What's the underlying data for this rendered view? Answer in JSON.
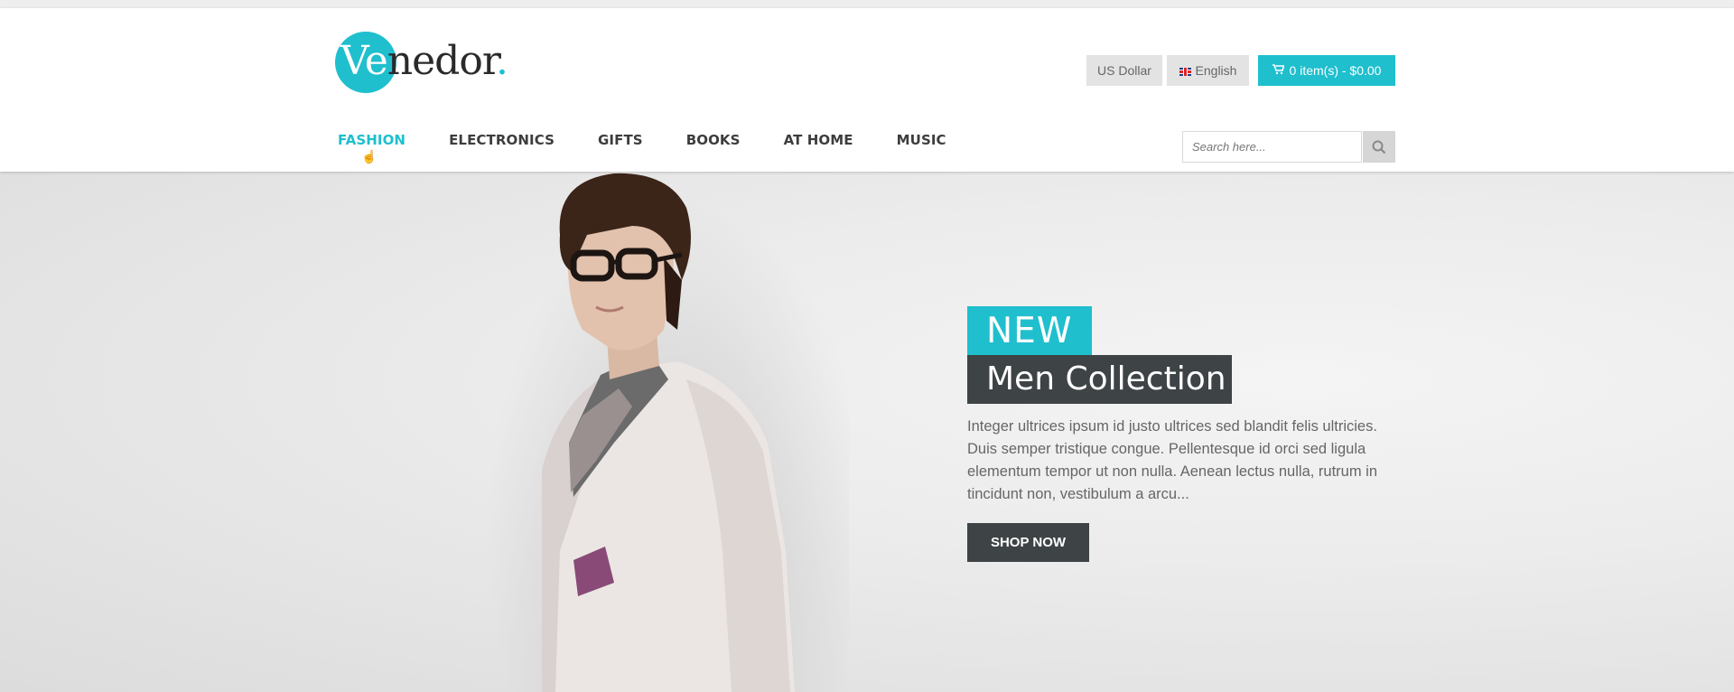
{
  "brand": {
    "logo_lead": "Ve",
    "logo_rest": "nedor",
    "logo_dot": ".",
    "accent_color": "#1fbfce",
    "dark_color": "#3e4346"
  },
  "topbar": {
    "currency_label": "US Dollar",
    "language_label": "English",
    "cart_label": "0 item(s) - $0.00"
  },
  "nav": {
    "items": [
      {
        "label": "FASHION",
        "active": true
      },
      {
        "label": "ELECTRONICS",
        "active": false
      },
      {
        "label": "GIFTS",
        "active": false
      },
      {
        "label": "BOOKS",
        "active": false
      },
      {
        "label": "AT HOME",
        "active": false
      },
      {
        "label": "MUSIC",
        "active": false
      }
    ]
  },
  "search": {
    "placeholder": "Search here...",
    "icon": "search-icon"
  },
  "hero": {
    "badge": "NEW",
    "title": "Men Collection",
    "description": "Integer ultrices ipsum id justo ultrices sed blandit felis ultricies. Duis semper tristique congue. Pellentesque id orci sed ligula elementum tempor ut non nulla. Aenean lectus nulla, rutrum in tincidunt non, vestibulum a arcu...",
    "button_label": "SHOP NOW"
  }
}
